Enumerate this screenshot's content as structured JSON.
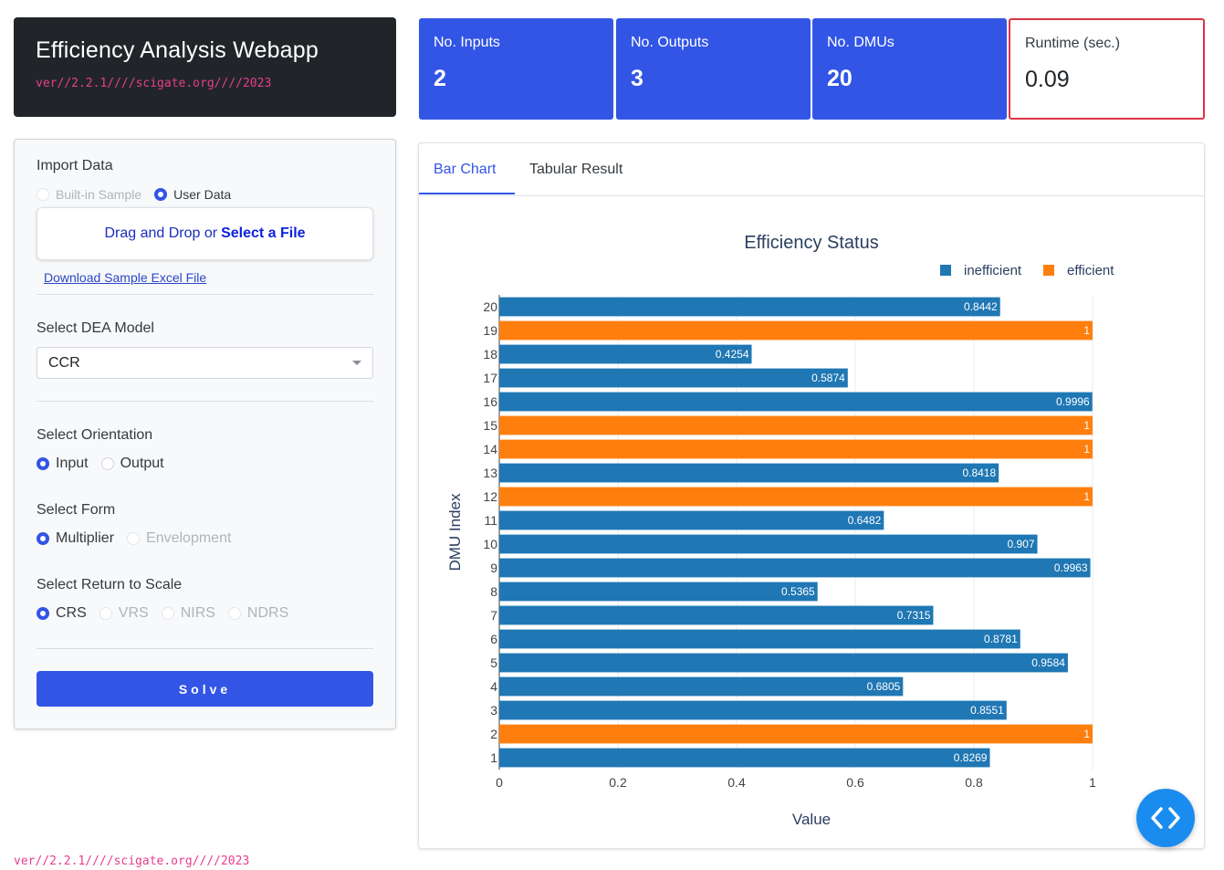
{
  "app": {
    "title": "Efficiency Analysis Webapp",
    "version": "ver//2.2.1////scigate.org////2023"
  },
  "sidebar": {
    "import": {
      "label": "Import Data",
      "options": [
        "Built-in Sample",
        "User Data"
      ],
      "selected": "User Data",
      "drop_text": "Drag and Drop or",
      "drop_link": "Select a File",
      "download_link": "Download Sample Excel File"
    },
    "model": {
      "label": "Select DEA Model",
      "value": "CCR"
    },
    "orientation": {
      "label": "Select Orientation",
      "options": [
        "Input",
        "Output"
      ],
      "selected": "Input"
    },
    "form": {
      "label": "Select Form",
      "options": [
        "Multiplier",
        "Envelopment"
      ],
      "selected": "Multiplier"
    },
    "rts": {
      "label": "Select Return to Scale",
      "options": [
        "CRS",
        "VRS",
        "NIRS",
        "NDRS"
      ],
      "selected": "CRS"
    },
    "solve_label": "Solve"
  },
  "stats": [
    {
      "label": "No. Inputs",
      "value": "2"
    },
    {
      "label": "No. Outputs",
      "value": "3"
    },
    {
      "label": "No. DMUs",
      "value": "20"
    },
    {
      "label": "Runtime (sec.)",
      "value": "0.09"
    }
  ],
  "tabs": [
    "Bar Chart",
    "Tabular Result"
  ],
  "active_tab": "Bar Chart",
  "icons": {
    "fab": "code-icon"
  },
  "colors": {
    "primary": "#3255e6",
    "inefficient": "#1f77b4",
    "efficient": "#ff7f0e",
    "runtime_border": "#dc3545"
  },
  "chart_data": {
    "type": "bar",
    "orientation": "horizontal",
    "title": "Efficiency Status",
    "xlabel": "Value",
    "ylabel": "DMU Index",
    "xlim": [
      0,
      1
    ],
    "xticks": [
      "0",
      "0.2",
      "0.4",
      "0.6",
      "0.8",
      "1"
    ],
    "legend_position": "top-right",
    "series": [
      {
        "name": "inefficient",
        "color": "#1f77b4"
      },
      {
        "name": "efficient",
        "color": "#ff7f0e"
      }
    ],
    "categories": [
      "1",
      "2",
      "3",
      "4",
      "5",
      "6",
      "7",
      "8",
      "9",
      "10",
      "11",
      "12",
      "13",
      "14",
      "15",
      "16",
      "17",
      "18",
      "19",
      "20"
    ],
    "values": [
      0.8269,
      1,
      0.8551,
      0.6805,
      0.9584,
      0.8781,
      0.7315,
      0.5365,
      0.9963,
      0.907,
      0.6482,
      1,
      0.8418,
      1,
      1,
      0.9996,
      0.5874,
      0.4254,
      1,
      0.8442
    ],
    "status": [
      "inefficient",
      "efficient",
      "inefficient",
      "inefficient",
      "inefficient",
      "inefficient",
      "inefficient",
      "inefficient",
      "inefficient",
      "inefficient",
      "inefficient",
      "efficient",
      "inefficient",
      "efficient",
      "efficient",
      "inefficient",
      "inefficient",
      "inefficient",
      "efficient",
      "inefficient"
    ],
    "labels": [
      "0.8269",
      "1",
      "0.8551",
      "0.6805",
      "0.9584",
      "0.8781",
      "0.7315",
      "0.5365",
      "0.9963",
      "0.907",
      "0.6482",
      "1",
      "0.8418",
      "1",
      "1",
      "0.9996",
      "0.5874",
      "0.4254",
      "1",
      "0.8442"
    ]
  }
}
